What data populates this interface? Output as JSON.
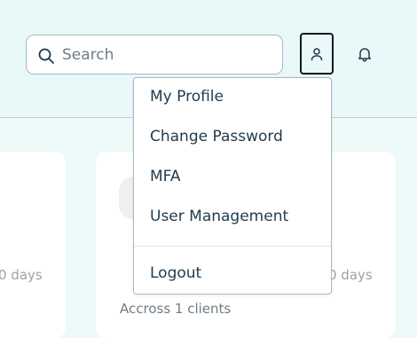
{
  "search": {
    "placeholder": "Search",
    "icon": "search-icon"
  },
  "header": {
    "user_icon": "user-icon",
    "bell_icon": "bell-icon"
  },
  "background": {
    "days_left": "0 days",
    "days_right": "0 days",
    "across": "Accross 1 clients"
  },
  "dropdown": {
    "items": [
      "My Profile",
      "Change Password",
      "MFA",
      "User Management"
    ],
    "logout": "Logout"
  },
  "colors": {
    "accent": "#1f3a4d",
    "header_bg": "#e9f8f8"
  }
}
